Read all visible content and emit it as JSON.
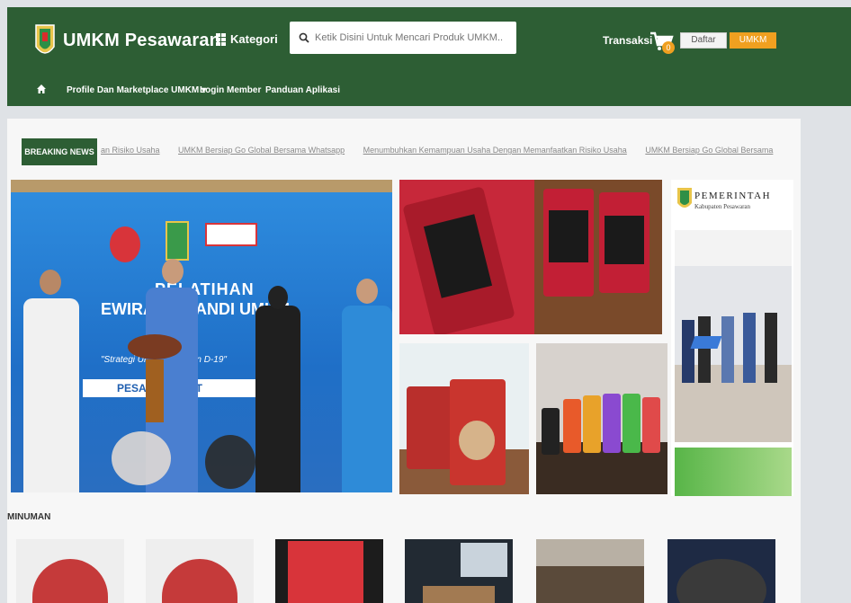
{
  "header": {
    "brand": "UMKM Pesawaran",
    "kategori_label": "Kategori",
    "search_placeholder": "Ketik Disini Untuk Mencari Produk UMKM...",
    "transaksi_label": "Transaksi",
    "cart_count": "0",
    "daftar_label": "Daftar",
    "umkm_label": "UMKM"
  },
  "nav": {
    "items": [
      {
        "label": "Profile Dan Marketplace UMKM ▾"
      },
      {
        "label": "Login Member"
      },
      {
        "label": "Panduan Aplikasi"
      }
    ]
  },
  "news": {
    "label": "BREAKING NEWS",
    "items": [
      "an Risiko Usaha",
      "UMKM Bersiap Go Global Bersama Whatsapp",
      "Menumbuhkan Kemampuan Usaha Dengan Memanfaatkan Risiko Usaha",
      "UMKM Bersiap Go Global Bersama"
    ]
  },
  "banner": {
    "title_line1": "PELATIHAN",
    "title_line2": "EWIRAUS        MANDI   UMKM",
    "subtitle": "\"Strategi Um          dimasa Pan        D-19\"",
    "date": "PESA          17 MARET"
  },
  "gov_banner": {
    "title": "PEMERINTAH",
    "subtitle": "Kabupaten Pesawaran"
  },
  "section": {
    "title": "MINUMAN"
  },
  "colors": {
    "header_green": "#2d5e34",
    "accent_orange": "#f0a020"
  }
}
